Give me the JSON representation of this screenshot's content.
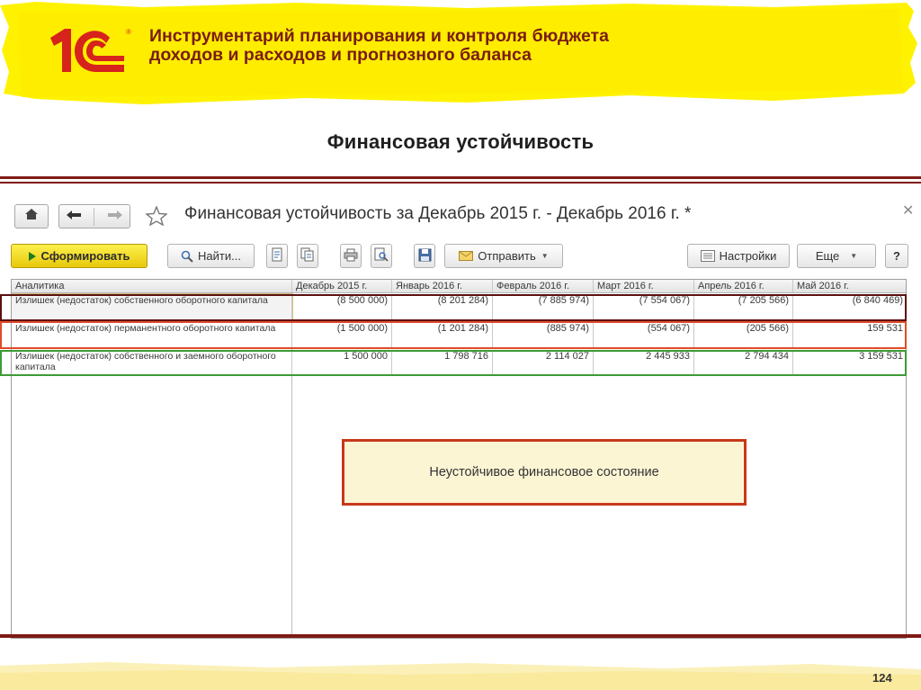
{
  "slide": {
    "title": "Инструментарий планирования и контроля бюджета доходов и расходов и прогнозного баланса",
    "section_title": "Финансовая устойчивость",
    "page_number": "124"
  },
  "window": {
    "title": "Финансовая устойчивость  за Декабрь 2015 г. - Декабрь 2016 г. *"
  },
  "toolbar": {
    "generate_label": "Сформировать",
    "find_label": "Найти...",
    "send_label": "Отправить",
    "settings_label": "Настройки",
    "more_label": "Еще",
    "help_label": "?"
  },
  "table": {
    "columns": [
      "Аналитика",
      "Декабрь 2015 г.",
      "Январь 2016 г.",
      "Февраль 2016 г.",
      "Март 2016 г.",
      "Апрель 2016 г.",
      "Май 2016 г."
    ],
    "rows": [
      {
        "name": "Излишек (недостаток) собственного оборотного капитала",
        "values": [
          "(8 500 000)",
          "(8 201 284)",
          "(7 885 974)",
          "(7 554 067)",
          "(7 205 566)",
          "(6 840 469)"
        ]
      },
      {
        "name": "Излишек (недостаток) перманентного оборотного капитала",
        "values": [
          "(1 500 000)",
          "(1 201 284)",
          "(885 974)",
          "(554 067)",
          "(205 566)",
          "159 531"
        ]
      },
      {
        "name": "Излишек (недостаток) собственного и заемного оборотного капитала",
        "values": [
          "1 500 000",
          "1 798 716",
          "2 114 027",
          "2 445 933",
          "2 794 434",
          "3 159 531"
        ]
      }
    ]
  },
  "callout": {
    "text": "Неустойчивое финансовое состояние"
  },
  "colors": {
    "accent_dark_red": "#7f1a14",
    "title_red": "#7a1c12",
    "banner_yellow": "#fff200",
    "callout_border": "#c8381b",
    "callout_fill": "#fcf5d4",
    "highlight_row1": "#5c1010",
    "highlight_row2": "#e04b2a",
    "highlight_row3": "#3d9a35"
  },
  "icons": [
    "home-icon",
    "back-arrow-icon",
    "forward-arrow-icon",
    "star-icon",
    "close-icon",
    "play-icon",
    "search-icon",
    "document-icon",
    "copy-icon",
    "print-icon",
    "preview-icon",
    "save-icon",
    "envelope-icon",
    "settings-list-icon"
  ]
}
